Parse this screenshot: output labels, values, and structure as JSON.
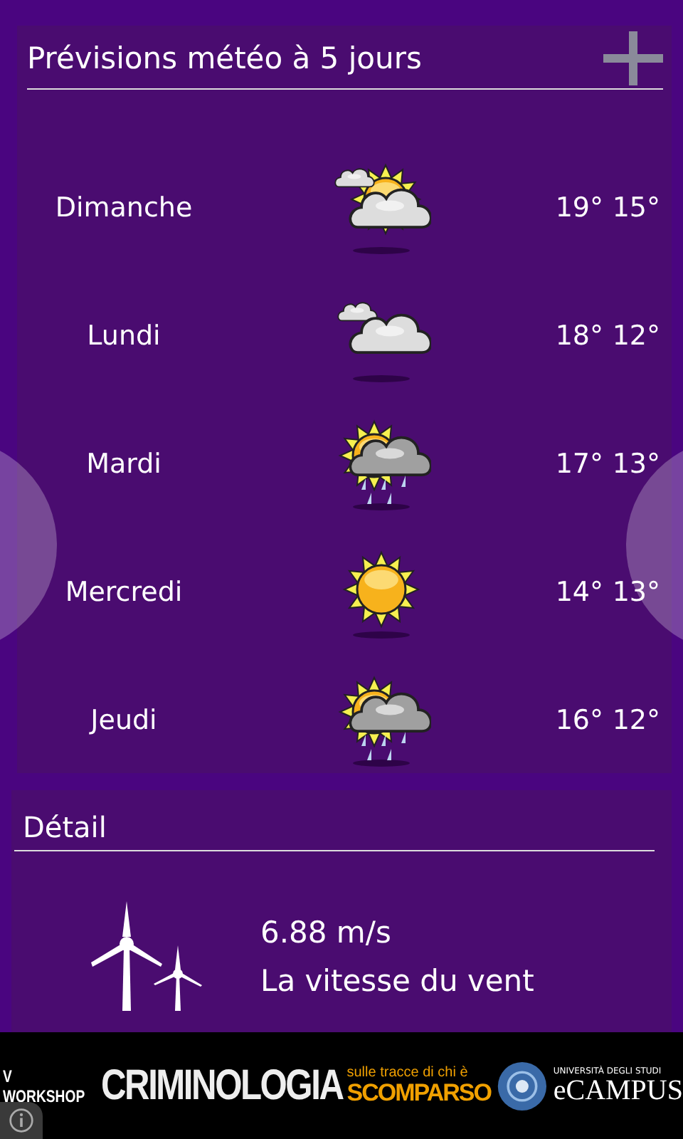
{
  "forecast": {
    "title": "Prévisions météo à 5 jours",
    "days": [
      {
        "day": "Dimanche",
        "kind": "partly_cloudy",
        "high": "19°",
        "low": "15°"
      },
      {
        "day": "Lundi",
        "kind": "cloudy",
        "high": "18°",
        "low": "12°"
      },
      {
        "day": "Mardi",
        "kind": "storm",
        "high": "17°",
        "low": "13°"
      },
      {
        "day": "Mercredi",
        "kind": "sunny",
        "high": "14°",
        "low": "13°"
      },
      {
        "day": "Jeudi",
        "kind": "storm",
        "high": "16°",
        "low": "12°"
      }
    ]
  },
  "detail": {
    "title": "Détail",
    "value": "6.88 m/s",
    "label": "La vitesse du vent"
  },
  "ad": {
    "workshop": "V WORKSHOP",
    "title": "CRIMINOLOGIA",
    "tagline": "sulle tracce di chi è",
    "tagline_bold": "SCOMPARSO",
    "brand_top": "UNIVERSITÀ DEGLI STUDI",
    "brand": "eCAMPUS"
  }
}
